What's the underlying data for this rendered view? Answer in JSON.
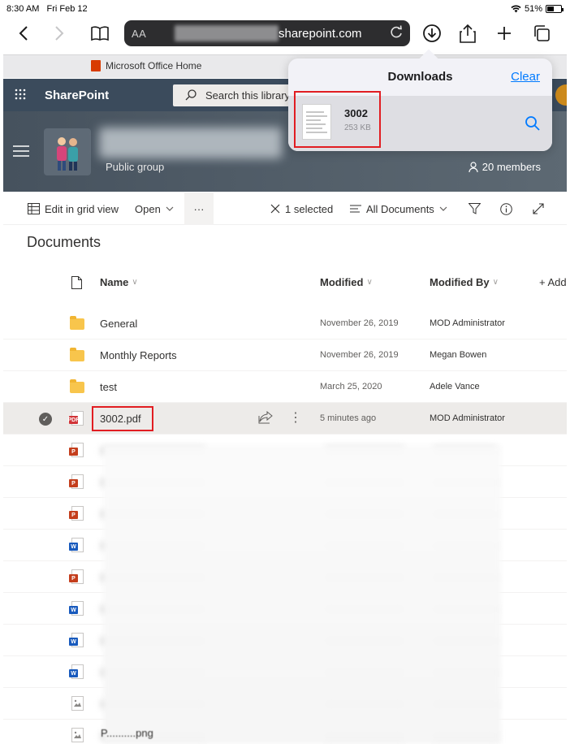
{
  "status_bar": {
    "time": "8:30 AM",
    "date": "Fri Feb 12",
    "battery": "51%",
    "battery_level": 0.51
  },
  "browser": {
    "text_size_label": "AA",
    "address": "sharepoint.com",
    "tab_title": "Microsoft Office Home"
  },
  "suite": {
    "app_name": "SharePoint",
    "search_placeholder": "Search this library"
  },
  "site": {
    "subtitle": "Public group",
    "members": "20 members"
  },
  "command_bar": {
    "edit_grid": "Edit in grid view",
    "open": "Open",
    "more": "···",
    "selected": "1 selected",
    "view": "All Documents"
  },
  "library": {
    "title": "Documents",
    "columns": {
      "name": "Name",
      "modified": "Modified",
      "modified_by": "Modified By",
      "add_column": "+ Add"
    },
    "rows": [
      {
        "name": "General",
        "modified": "November 26, 2019",
        "modified_by": "MOD Administrator",
        "type": "folder"
      },
      {
        "name": "Monthly Reports",
        "modified": "November 26, 2019",
        "modified_by": "Megan Bowen",
        "type": "folder"
      },
      {
        "name": "test",
        "modified": "March 25, 2020",
        "modified_by": "Adele Vance",
        "type": "folder"
      },
      {
        "name": "3002.pdf",
        "modified": "5 minutes ago",
        "modified_by": "MOD Administrator",
        "type": "pdf",
        "selected": true
      }
    ],
    "blurred_icons": [
      "powerpoint",
      "powerpoint",
      "powerpoint",
      "word",
      "powerpoint",
      "word",
      "word",
      "word",
      "image",
      "image"
    ],
    "partial_last_name": "P..........png"
  },
  "downloads": {
    "title": "Downloads",
    "clear": "Clear",
    "item": {
      "name": "3002",
      "size": "253 KB"
    }
  },
  "colors": {
    "suite_bar": "#3b4b5c",
    "accent_link": "#007aff",
    "highlight": "#e11d22"
  }
}
